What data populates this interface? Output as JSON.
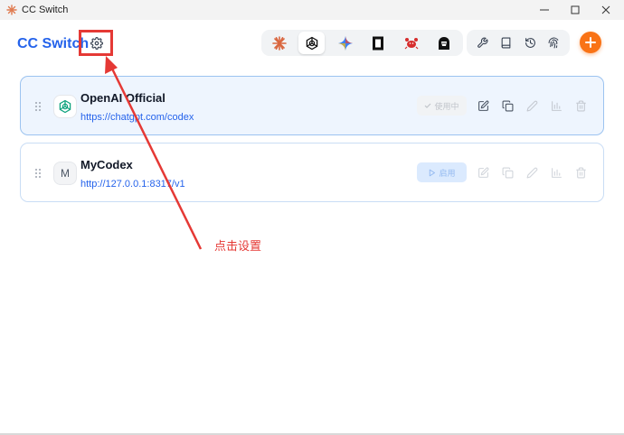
{
  "window": {
    "title": "CC Switch",
    "icons": {
      "app": "cc-switch-logo-icon",
      "minimize": "minimize-icon",
      "maximize": "maximize-icon",
      "close": "close-icon"
    }
  },
  "header": {
    "brand": "CC Switch",
    "settings_icon": "gear-icon",
    "providers": [
      "claude-icon",
      "openai-icon",
      "gemini-icon",
      "opencode-icon",
      "crab-icon",
      "hacker-icon"
    ],
    "active_provider_index": 1,
    "tools": [
      "wrench-icon",
      "book-icon",
      "history-icon",
      "fingerprint-icon"
    ],
    "add_icon": "plus-icon"
  },
  "providers": [
    {
      "name": "OpenAI Official",
      "url": "https://chatgpt.com/codex",
      "avatar_icon": "openai-icon",
      "status_label": "使用中",
      "status_icon": "check-icon",
      "active": true
    },
    {
      "name": "MyCodex",
      "url": "http://127.0.0.1:8317/v1",
      "avatar_letter": "M",
      "status_label": "启用",
      "status_icon": "play-icon",
      "active": false
    }
  ],
  "card_actions": [
    "edit-icon",
    "copy-icon",
    "pen-icon",
    "chart-icon",
    "trash-icon"
  ],
  "annotation": {
    "text": "点击设置"
  },
  "colors": {
    "brand": "#2563eb",
    "accent": "#f97316",
    "annotation": "#e53935"
  }
}
